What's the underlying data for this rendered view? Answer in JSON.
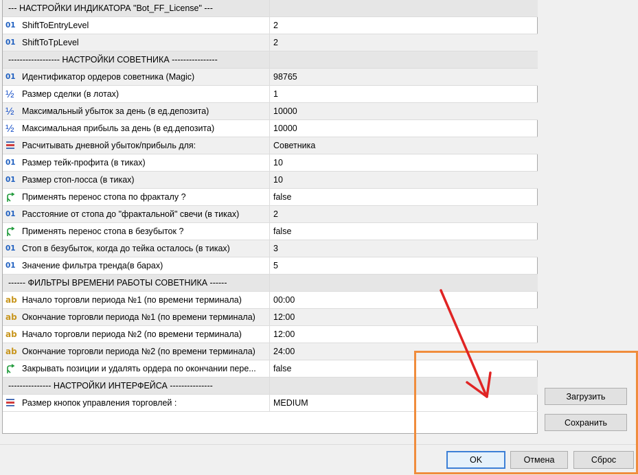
{
  "rows": [
    {
      "type": "header",
      "label": "---   НАСТРОЙКИ ИНДИКАТОРА \"Bot_FF_License\"   ---",
      "value": ""
    },
    {
      "type": "int",
      "icon": "int-icon",
      "label": "ShiftToEntryLevel",
      "value": "2"
    },
    {
      "type": "int",
      "icon": "int-icon",
      "label": "ShiftToTpLevel",
      "value": "2"
    },
    {
      "type": "header",
      "label": "------------------   НАСТРОЙКИ СОВЕТНИКА   ----------------",
      "value": ""
    },
    {
      "type": "int",
      "icon": "int-icon",
      "label": "Идентификатор ордеров советника (Magic)",
      "value": "98765"
    },
    {
      "type": "double",
      "icon": "double-icon",
      "label": "Размер сделки (в лотах)",
      "value": "1"
    },
    {
      "type": "double",
      "icon": "double-icon",
      "label": "Максимальный убыток за день (в ед.депозита)",
      "value": "10000"
    },
    {
      "type": "double",
      "icon": "double-icon",
      "label": "Максимальная прибыль за день (в ед.депозита)",
      "value": "10000"
    },
    {
      "type": "enum",
      "icon": "enum-icon",
      "label": "Расчитывать дневной убыток/прибыль для:",
      "value": "Советника"
    },
    {
      "type": "int",
      "icon": "int-icon",
      "label": "Размер тейк-профита (в тиках)",
      "value": "10"
    },
    {
      "type": "int",
      "icon": "int-icon",
      "label": "Размер стоп-лосса (в тиках)",
      "value": "10"
    },
    {
      "type": "bool",
      "icon": "bool-icon",
      "label": "Применять перенос стопа по фракталу ?",
      "value": "false"
    },
    {
      "type": "int",
      "icon": "int-icon",
      "label": "Расстояние от стопа до \"фрактальной\" свечи (в тиках)",
      "value": "2"
    },
    {
      "type": "bool",
      "icon": "bool-icon",
      "label": "Применять перенос стопа в безубыток ?",
      "value": "false"
    },
    {
      "type": "int",
      "icon": "int-icon",
      "label": "Стоп в безубыток, когда до тейка осталось (в тиках)",
      "value": "3"
    },
    {
      "type": "int",
      "icon": "int-icon",
      "label": "Значение фильтра тренда(в барах)",
      "value": "5"
    },
    {
      "type": "header",
      "label": "------   ФИЛЬТРЫ ВРЕМЕНИ РАБОТЫ СОВЕТНИКА   ------",
      "value": ""
    },
    {
      "type": "string",
      "icon": "string-icon",
      "label": "Начало торговли периода №1 (по времени терминала)",
      "value": "00:00"
    },
    {
      "type": "string",
      "icon": "string-icon",
      "label": "Окончание торговли периода №1 (по времени терминала)",
      "value": "12:00"
    },
    {
      "type": "string",
      "icon": "string-icon",
      "label": "Начало торговли периода №2 (по времени терминала)",
      "value": "12:00"
    },
    {
      "type": "string",
      "icon": "string-icon",
      "label": "Окончание торговли периода №2 (по времени терминала)",
      "value": "24:00"
    },
    {
      "type": "bool",
      "icon": "bool-icon",
      "label": "Закрывать позиции и удалять ордера по окончании пере...",
      "value": "false"
    },
    {
      "type": "header",
      "label": "---------------   НАСТРОЙКИ ИНТЕРФЕЙСА   ---------------",
      "value": ""
    },
    {
      "type": "enum",
      "icon": "enum-icon",
      "label": "Размер кнопок управления торговлей :",
      "value": "MEDIUM"
    }
  ],
  "icons": {
    "int": "01",
    "double": "½",
    "string": "ab"
  },
  "buttons": {
    "load": "Загрузить",
    "save": "Сохранить",
    "ok": "OK",
    "cancel": "Отмена",
    "reset": "Сброс"
  },
  "colors": {
    "highlight": "#f08c3c",
    "arrow": "#e02424",
    "bool_icon": "#1f9a3a"
  }
}
